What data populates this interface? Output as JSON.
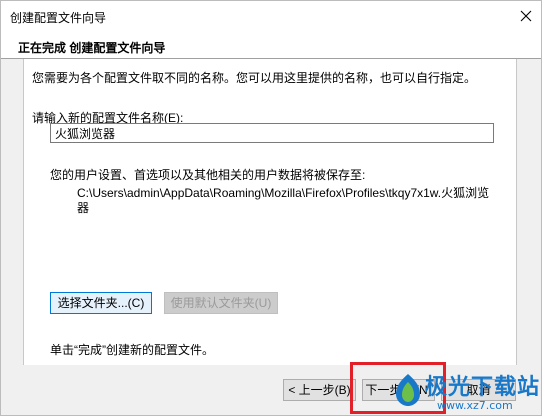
{
  "window": {
    "title": "创建配置文件向导",
    "close_icon": "close-icon"
  },
  "header": {
    "title": "正在完成 创建配置文件向导"
  },
  "content": {
    "intro": "您需要为各个配置文件取不同的名称。您可以用这里提供的名称，也可以自行指定。",
    "name_label": "请输入新的配置文件名称(E):",
    "name_value": "火狐浏览器",
    "save_desc": "您的用户设置、首选项以及其他相关的用户数据将被保存至:",
    "save_path": "C:\\Users\\admin\\AppData\\Roaming\\Mozilla\\Firefox\\Profiles\\tkqy7x1w.火狐浏览器",
    "choose_folder_label": "选择文件夹...(C)",
    "default_folder_label": "使用默认文件夹(U)",
    "finish_note": "单击“完成”创建新的配置文件。"
  },
  "footer": {
    "back_label": "< 上一步(B)",
    "next_label": "下一步 > (N)",
    "cancel_label": "取消"
  },
  "watermark": {
    "text": "极光下载站",
    "url": "www.xz7.com"
  },
  "colors": {
    "highlight": "#e2202a",
    "watermark": "#1a78c8",
    "focus_border": "#0078d7"
  }
}
